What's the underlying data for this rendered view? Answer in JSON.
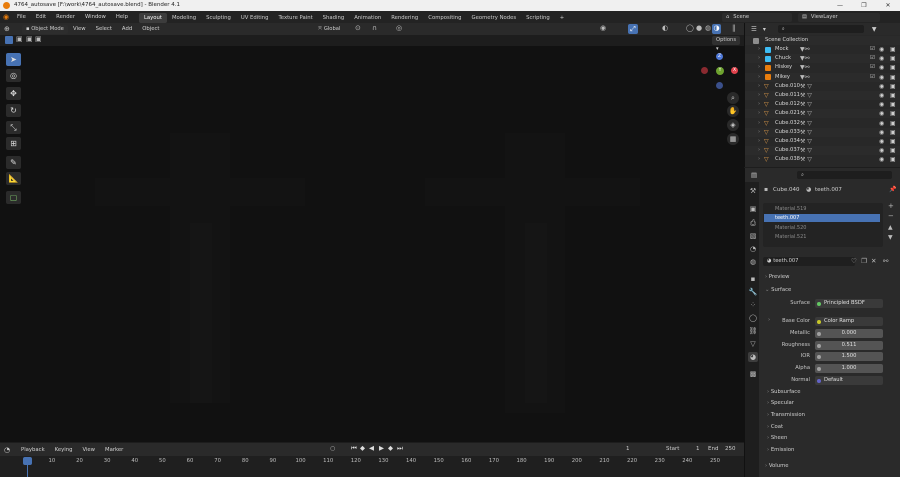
{
  "title": "4764_autosave [F:\\work\\4764_autosave.blend] - Blender 4.1",
  "window_controls": [
    "—",
    "❐",
    "✕"
  ],
  "menu": [
    "File",
    "Edit",
    "Render",
    "Window",
    "Help"
  ],
  "workspaces": [
    "Layout",
    "Modeling",
    "Sculpting",
    "UV Editing",
    "Texture Paint",
    "Shading",
    "Animation",
    "Rendering",
    "Compositing",
    "Geometry Nodes",
    "Scripting",
    "+"
  ],
  "scene": "Scene",
  "view_layer": "ViewLayer",
  "viewport_header": {
    "mode": "Object Mode",
    "menus": [
      "View",
      "Select",
      "Add",
      "Object"
    ],
    "orientation": "Global",
    "options": "Options"
  },
  "outliner": {
    "search_placeholder": "",
    "collection": "Scene Collection",
    "items": [
      "Mock",
      "Chuck",
      "Hiskey",
      "Mikey",
      "Cube.010",
      "Cube.011",
      "Cube.012",
      "Cube.021",
      "Cube.032",
      "Cube.033",
      "Cube.034",
      "Cube.037",
      "Cube.038"
    ]
  },
  "properties": {
    "breadcrumb_object": "Cube.040",
    "breadcrumb_material": "teeth.007",
    "material_slots": [
      "Material.519",
      "teeth.007",
      "Material.520",
      "Material.521"
    ],
    "active_material": "teeth.007",
    "sections": {
      "preview": "Preview",
      "surface": "Surface",
      "subsurface": "Subsurface",
      "specular": "Specular",
      "transmission": "Transmission",
      "coat": "Coat",
      "sheen": "Sheen",
      "emission": "Emission",
      "volume": "Volume"
    },
    "surface_shader": "Principled BSDF",
    "fields": [
      {
        "label": "Base Color",
        "value": "Color Ramp"
      },
      {
        "label": "Metallic",
        "value": "0.000"
      },
      {
        "label": "Roughness",
        "value": "0.511"
      },
      {
        "label": "IOR",
        "value": "1.500"
      },
      {
        "label": "Alpha",
        "value": "1.000"
      },
      {
        "label": "Normal",
        "value": "Default"
      }
    ],
    "surface_label": "Surface"
  },
  "timeline": {
    "menus": [
      "Playback",
      "Keying",
      "View",
      "Marker"
    ],
    "current_frame": "1",
    "start_label": "Start",
    "start": "1",
    "end_label": "End",
    "end": "250",
    "ticks": [
      "1",
      "10",
      "20",
      "30",
      "40",
      "50",
      "60",
      "70",
      "80",
      "90",
      "100",
      "110",
      "120",
      "130",
      "140",
      "150",
      "160",
      "170",
      "180",
      "190",
      "200",
      "210",
      "220",
      "230",
      "240",
      "250"
    ]
  },
  "colors": {
    "accent": "#4772b3",
    "blender_orange": "#e87d0d",
    "axis_x": "#e0424c",
    "axis_y": "#6ea32f",
    "axis_z": "#4f79d9"
  }
}
